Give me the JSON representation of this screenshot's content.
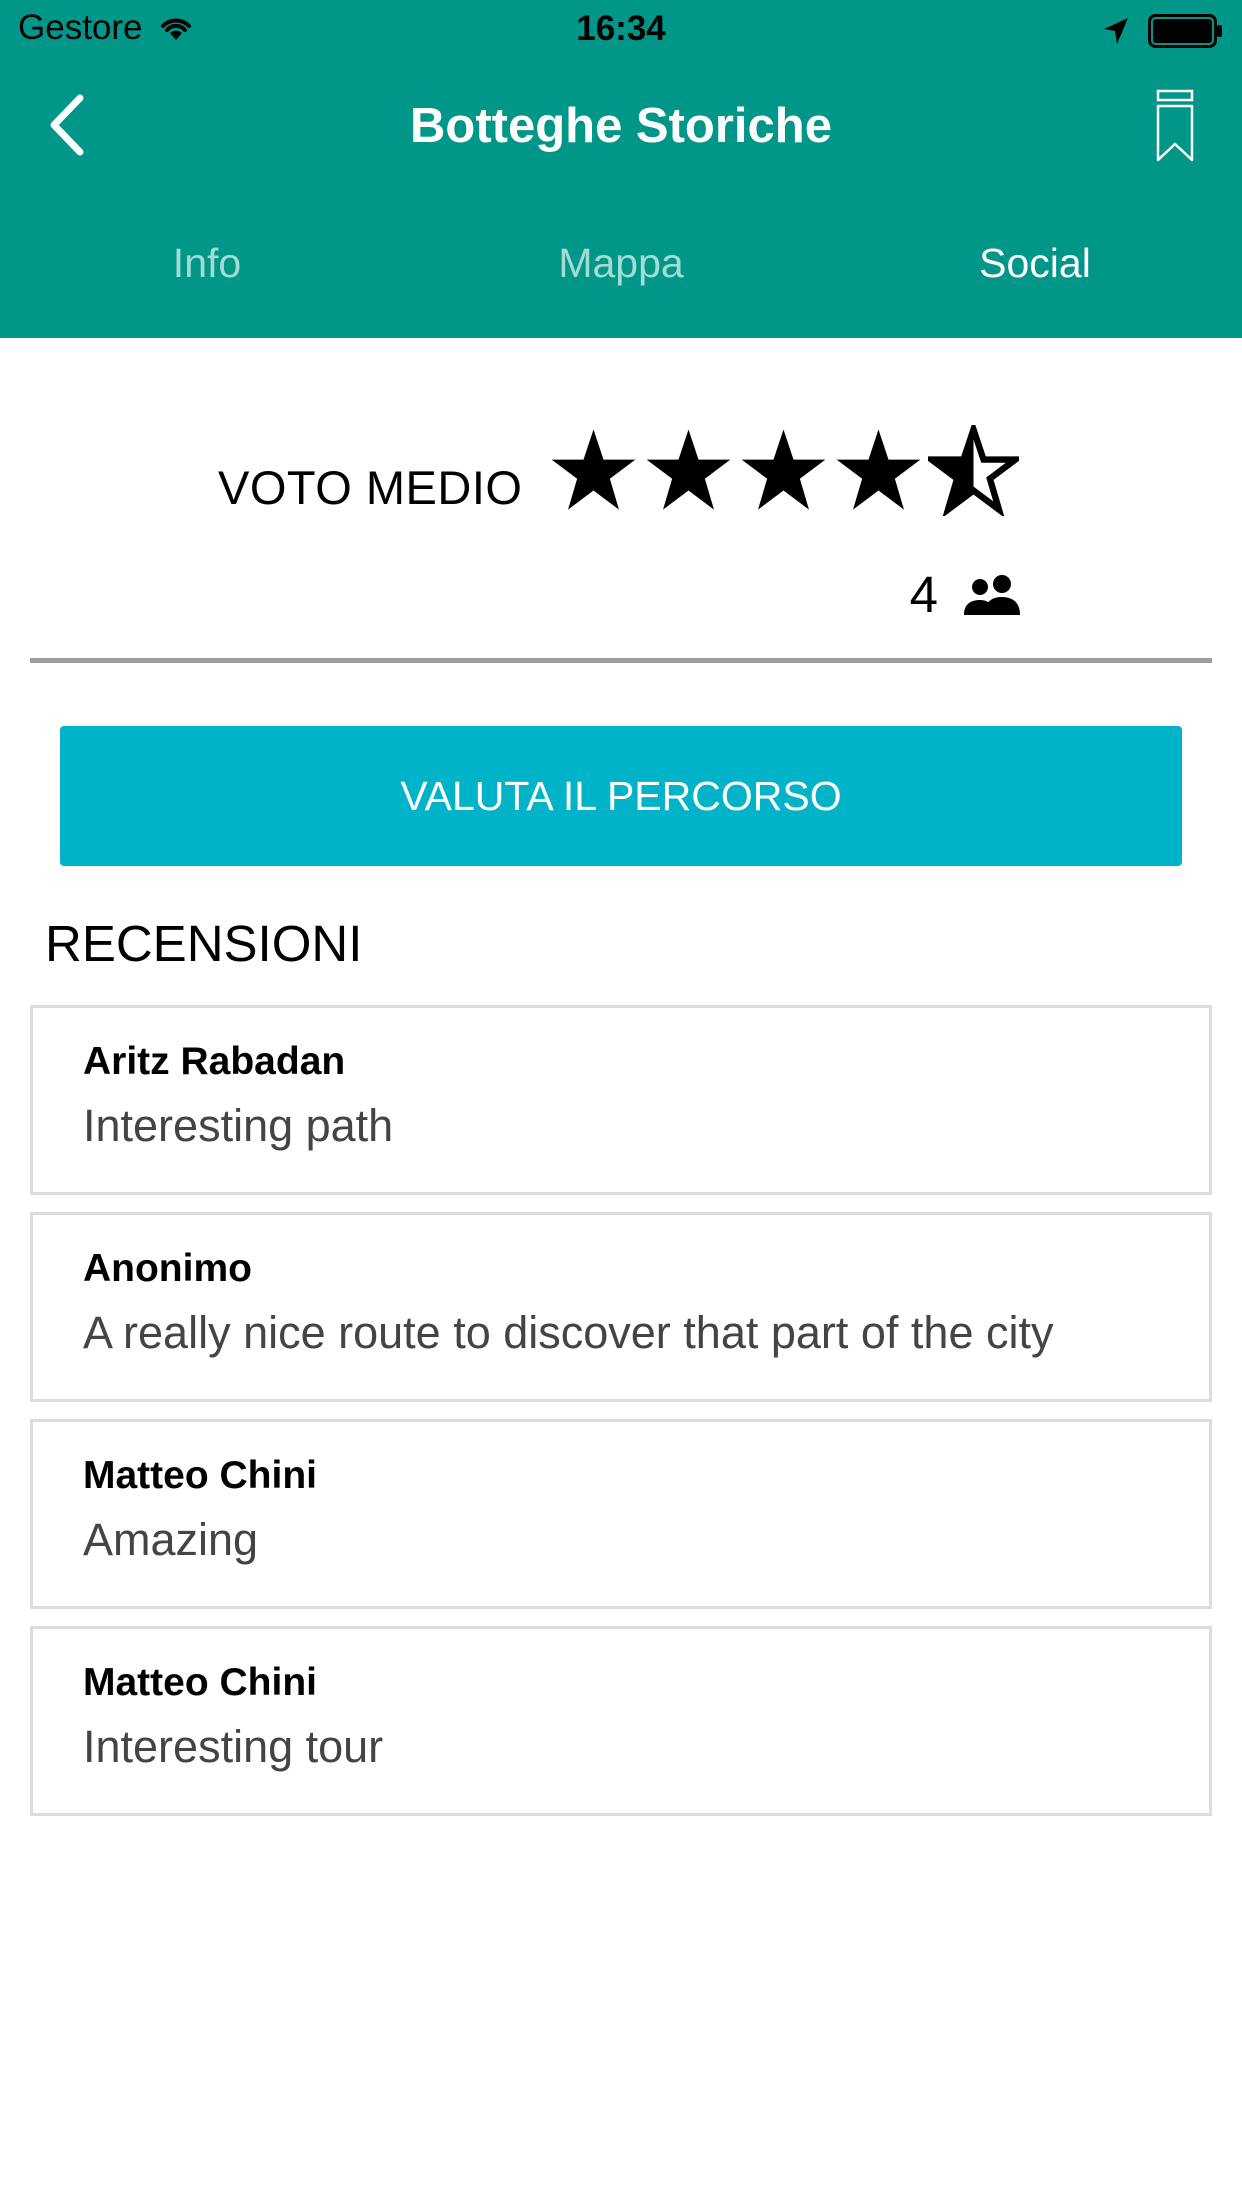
{
  "status_bar": {
    "carrier": "Gestore",
    "time": "16:34"
  },
  "nav": {
    "title": "Botteghe Storiche"
  },
  "tabs": [
    {
      "label": "Info",
      "active": false
    },
    {
      "label": "Mappa",
      "active": false
    },
    {
      "label": "Social",
      "active": true
    }
  ],
  "rating": {
    "label": "VOTO MEDIO",
    "average": 4.5,
    "max": 5,
    "count": "4"
  },
  "rate_button": {
    "label": "VALUTA IL PERCORSO"
  },
  "reviews_section": {
    "title": "RECENSIONI",
    "items": [
      {
        "author": "Aritz Rabadan",
        "text": "Interesting path"
      },
      {
        "author": "Anonimo",
        "text": "A really nice route to discover that part of the city"
      },
      {
        "author": "Matteo Chini",
        "text": "Amazing"
      },
      {
        "author": "Matteo Chini",
        "text": "Interesting tour"
      }
    ]
  },
  "colors": {
    "header": "#009688",
    "tab_active": "#ffffff",
    "tab_inactive": "#a3dcd4",
    "button": "#00b3c8",
    "divider": "#9e9e9e"
  },
  "icons": [
    "wifi-icon",
    "location-arrow-icon",
    "battery-icon",
    "back-chevron-icon",
    "bookmark-icon",
    "star-icon",
    "users-icon"
  ]
}
